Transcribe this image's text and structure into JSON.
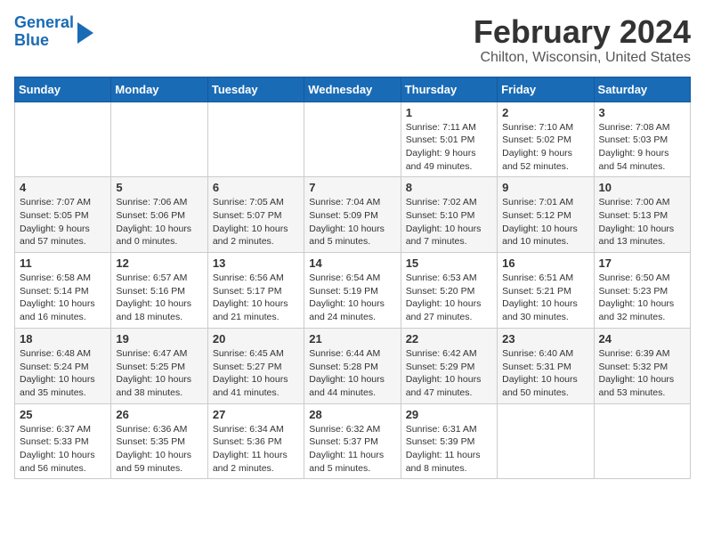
{
  "header": {
    "logo_line1": "General",
    "logo_line2": "Blue",
    "title": "February 2024",
    "subtitle": "Chilton, Wisconsin, United States"
  },
  "days_of_week": [
    "Sunday",
    "Monday",
    "Tuesday",
    "Wednesday",
    "Thursday",
    "Friday",
    "Saturday"
  ],
  "weeks": [
    {
      "row_class": "row-white",
      "days": [
        {
          "num": "",
          "info": ""
        },
        {
          "num": "",
          "info": ""
        },
        {
          "num": "",
          "info": ""
        },
        {
          "num": "",
          "info": ""
        },
        {
          "num": "1",
          "info": "Sunrise: 7:11 AM\nSunset: 5:01 PM\nDaylight: 9 hours\nand 49 minutes."
        },
        {
          "num": "2",
          "info": "Sunrise: 7:10 AM\nSunset: 5:02 PM\nDaylight: 9 hours\nand 52 minutes."
        },
        {
          "num": "3",
          "info": "Sunrise: 7:08 AM\nSunset: 5:03 PM\nDaylight: 9 hours\nand 54 minutes."
        }
      ]
    },
    {
      "row_class": "row-gray",
      "days": [
        {
          "num": "4",
          "info": "Sunrise: 7:07 AM\nSunset: 5:05 PM\nDaylight: 9 hours\nand 57 minutes."
        },
        {
          "num": "5",
          "info": "Sunrise: 7:06 AM\nSunset: 5:06 PM\nDaylight: 10 hours\nand 0 minutes."
        },
        {
          "num": "6",
          "info": "Sunrise: 7:05 AM\nSunset: 5:07 PM\nDaylight: 10 hours\nand 2 minutes."
        },
        {
          "num": "7",
          "info": "Sunrise: 7:04 AM\nSunset: 5:09 PM\nDaylight: 10 hours\nand 5 minutes."
        },
        {
          "num": "8",
          "info": "Sunrise: 7:02 AM\nSunset: 5:10 PM\nDaylight: 10 hours\nand 7 minutes."
        },
        {
          "num": "9",
          "info": "Sunrise: 7:01 AM\nSunset: 5:12 PM\nDaylight: 10 hours\nand 10 minutes."
        },
        {
          "num": "10",
          "info": "Sunrise: 7:00 AM\nSunset: 5:13 PM\nDaylight: 10 hours\nand 13 minutes."
        }
      ]
    },
    {
      "row_class": "row-white",
      "days": [
        {
          "num": "11",
          "info": "Sunrise: 6:58 AM\nSunset: 5:14 PM\nDaylight: 10 hours\nand 16 minutes."
        },
        {
          "num": "12",
          "info": "Sunrise: 6:57 AM\nSunset: 5:16 PM\nDaylight: 10 hours\nand 18 minutes."
        },
        {
          "num": "13",
          "info": "Sunrise: 6:56 AM\nSunset: 5:17 PM\nDaylight: 10 hours\nand 21 minutes."
        },
        {
          "num": "14",
          "info": "Sunrise: 6:54 AM\nSunset: 5:19 PM\nDaylight: 10 hours\nand 24 minutes."
        },
        {
          "num": "15",
          "info": "Sunrise: 6:53 AM\nSunset: 5:20 PM\nDaylight: 10 hours\nand 27 minutes."
        },
        {
          "num": "16",
          "info": "Sunrise: 6:51 AM\nSunset: 5:21 PM\nDaylight: 10 hours\nand 30 minutes."
        },
        {
          "num": "17",
          "info": "Sunrise: 6:50 AM\nSunset: 5:23 PM\nDaylight: 10 hours\nand 32 minutes."
        }
      ]
    },
    {
      "row_class": "row-gray",
      "days": [
        {
          "num": "18",
          "info": "Sunrise: 6:48 AM\nSunset: 5:24 PM\nDaylight: 10 hours\nand 35 minutes."
        },
        {
          "num": "19",
          "info": "Sunrise: 6:47 AM\nSunset: 5:25 PM\nDaylight: 10 hours\nand 38 minutes."
        },
        {
          "num": "20",
          "info": "Sunrise: 6:45 AM\nSunset: 5:27 PM\nDaylight: 10 hours\nand 41 minutes."
        },
        {
          "num": "21",
          "info": "Sunrise: 6:44 AM\nSunset: 5:28 PM\nDaylight: 10 hours\nand 44 minutes."
        },
        {
          "num": "22",
          "info": "Sunrise: 6:42 AM\nSunset: 5:29 PM\nDaylight: 10 hours\nand 47 minutes."
        },
        {
          "num": "23",
          "info": "Sunrise: 6:40 AM\nSunset: 5:31 PM\nDaylight: 10 hours\nand 50 minutes."
        },
        {
          "num": "24",
          "info": "Sunrise: 6:39 AM\nSunset: 5:32 PM\nDaylight: 10 hours\nand 53 minutes."
        }
      ]
    },
    {
      "row_class": "row-white",
      "days": [
        {
          "num": "25",
          "info": "Sunrise: 6:37 AM\nSunset: 5:33 PM\nDaylight: 10 hours\nand 56 minutes."
        },
        {
          "num": "26",
          "info": "Sunrise: 6:36 AM\nSunset: 5:35 PM\nDaylight: 10 hours\nand 59 minutes."
        },
        {
          "num": "27",
          "info": "Sunrise: 6:34 AM\nSunset: 5:36 PM\nDaylight: 11 hours\nand 2 minutes."
        },
        {
          "num": "28",
          "info": "Sunrise: 6:32 AM\nSunset: 5:37 PM\nDaylight: 11 hours\nand 5 minutes."
        },
        {
          "num": "29",
          "info": "Sunrise: 6:31 AM\nSunset: 5:39 PM\nDaylight: 11 hours\nand 8 minutes."
        },
        {
          "num": "",
          "info": ""
        },
        {
          "num": "",
          "info": ""
        }
      ]
    }
  ]
}
